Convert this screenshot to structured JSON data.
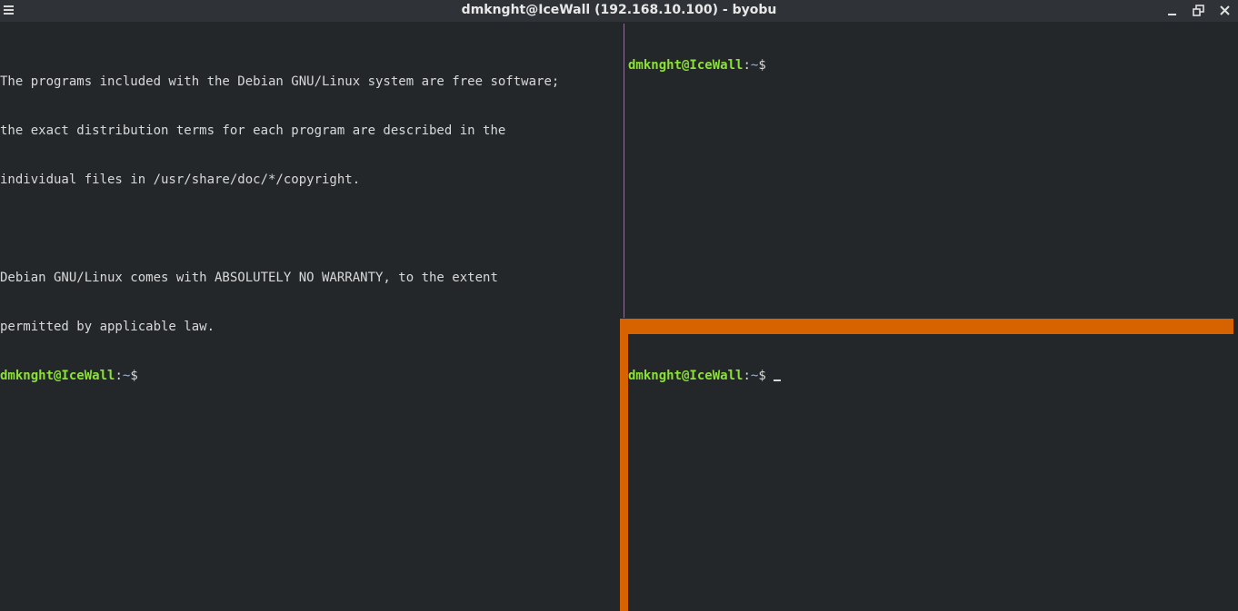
{
  "window": {
    "title": "dmknght@IceWall (192.168.10.100) - byobu",
    "menu_icon": "hamburger-menu-icon",
    "buttons": [
      "minimize-icon",
      "restore-icon",
      "close-icon"
    ]
  },
  "colors": {
    "background": "#24272a",
    "titlebar": "#2f3236",
    "prompt_user": "#8ae234",
    "prompt_path": "#8ab4f8",
    "active_pane_border": "#d66300",
    "pane_divider": "#8e6f95"
  },
  "panes": {
    "left": {
      "lines": [
        "The programs included with the Debian GNU/Linux system are free software;",
        "the exact distribution terms for each program are described in the",
        "individual files in /usr/share/doc/*/copyright.",
        "",
        "Debian GNU/Linux comes with ABSOLUTELY NO WARRANTY, to the extent",
        "permitted by applicable law."
      ],
      "prompt": {
        "user": "dmknght@IceWall",
        "sep": ":",
        "path": "~",
        "symbol": "$"
      }
    },
    "top_right": {
      "prompt": {
        "user": "dmknght@IceWall",
        "sep": ":",
        "path": "~",
        "symbol": "$"
      }
    },
    "bottom_right": {
      "prompt": {
        "user": "dmknght@IceWall",
        "sep": ":",
        "path": "~",
        "symbol": "$ "
      },
      "active": true
    }
  }
}
